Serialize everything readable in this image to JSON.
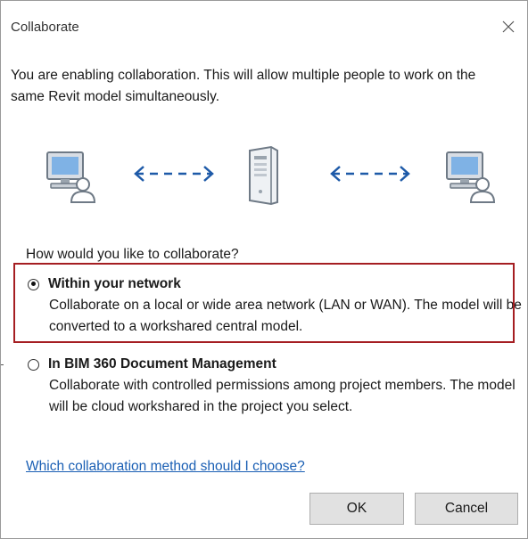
{
  "window": {
    "title": "Collaborate",
    "close_icon": "close-icon"
  },
  "intro_text": "You are enabling collaboration. This will allow multiple people to work on the same Revit model simultaneously.",
  "graphic": {
    "left_icon": "workstation-user-icon",
    "left_arrow": "double-arrow-icon",
    "center_icon": "server-icon",
    "right_arrow": "double-arrow-icon",
    "right_icon": "workstation-user-icon",
    "arrow_text": "←--→"
  },
  "question": "How would you like to collaborate?",
  "options": [
    {
      "title": "Within your network",
      "description": "Collaborate on a local or wide area network (LAN or WAN). The model will be converted to a workshared central model.",
      "selected": true
    },
    {
      "title": "In BIM 360 Document Management",
      "description": "Collaborate with controlled permissions among project members. The model will be cloud workshared in the project you select.",
      "selected": false
    }
  ],
  "help_link": "Which collaboration method should I choose?",
  "buttons": {
    "ok": "OK",
    "cancel": "Cancel"
  },
  "colors": {
    "highlight_border": "#a51e22",
    "link": "#1a5fb4",
    "arrow": "#1e5aa8"
  }
}
